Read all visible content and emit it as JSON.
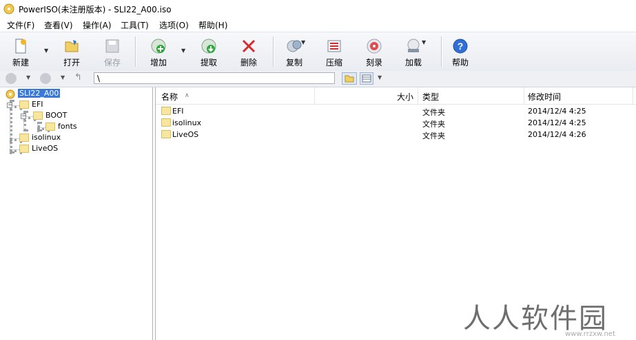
{
  "window": {
    "title": "PowerISO(未注册版本) - SLI22_A00.iso"
  },
  "menu": [
    "文件(F)",
    "查看(V)",
    "操作(A)",
    "工具(T)",
    "选项(O)",
    "帮助(H)"
  ],
  "toolbar": {
    "new": "新建",
    "open": "打开",
    "save": "保存",
    "add": "增加",
    "extract": "提取",
    "delete": "删除",
    "copy": "复制",
    "compress": "压缩",
    "burn": "刻录",
    "mount": "加载",
    "help": "帮助"
  },
  "address": {
    "path": "\\"
  },
  "tree": {
    "root": "SLI22_A00",
    "efi": "EFI",
    "boot": "BOOT",
    "fonts": "fonts",
    "isolinux": "isolinux",
    "liveos": "LiveOS"
  },
  "list": {
    "headers": {
      "name": "名称",
      "size": "大小",
      "type": "类型",
      "modified": "修改时间"
    },
    "rows": [
      {
        "name": "EFI",
        "type": "文件夹",
        "modified": "2014/12/4 4:25"
      },
      {
        "name": "isolinux",
        "type": "文件夹",
        "modified": "2014/12/4 4:25"
      },
      {
        "name": "LiveOS",
        "type": "文件夹",
        "modified": "2014/12/4 4:26"
      }
    ]
  },
  "watermark": {
    "text": "人人软件园",
    "url": "www.rrzxw.net"
  },
  "colors": {
    "selection": "#3b79d6",
    "folder": "#f7e6a0",
    "toolbar_bg": "#e9ecf1"
  }
}
